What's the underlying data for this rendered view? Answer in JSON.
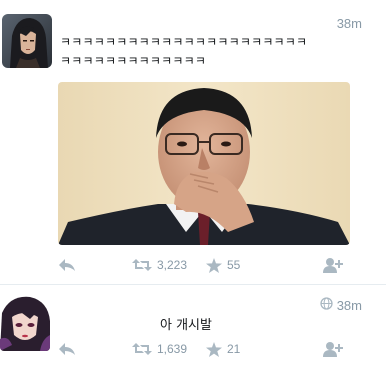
{
  "tweets": [
    {
      "timestamp": "38m",
      "text_line1": "ㅋㅋㅋㅋㅋㅋㅋㅋㅋㅋㅋㅋㅋㅋㅋㅋㅋㅋㅋㅋㅋㅋ",
      "text_line2": "ㅋㅋㅋㅋㅋㅋㅋㅋㅋㅋㅋㅋㅋ",
      "has_media": true,
      "actions": {
        "reply_icon": "reply-icon",
        "retweet_icon": "retweet-icon",
        "retweets": "3,223",
        "like_icon": "star-icon",
        "likes": "55",
        "follow_icon": "add-user-icon"
      }
    },
    {
      "timestamp": "38m",
      "visibility_icon": "globe-icon",
      "text": "아 개시발",
      "actions": {
        "reply_icon": "reply-icon",
        "retweet_icon": "retweet-icon",
        "retweets": "1,639",
        "like_icon": "star-icon",
        "likes": "21",
        "follow_icon": "add-user-icon"
      }
    }
  ],
  "colors": {
    "meta_gray": "#8899a6",
    "text": "#14171a",
    "divider": "#e6ecf0"
  }
}
